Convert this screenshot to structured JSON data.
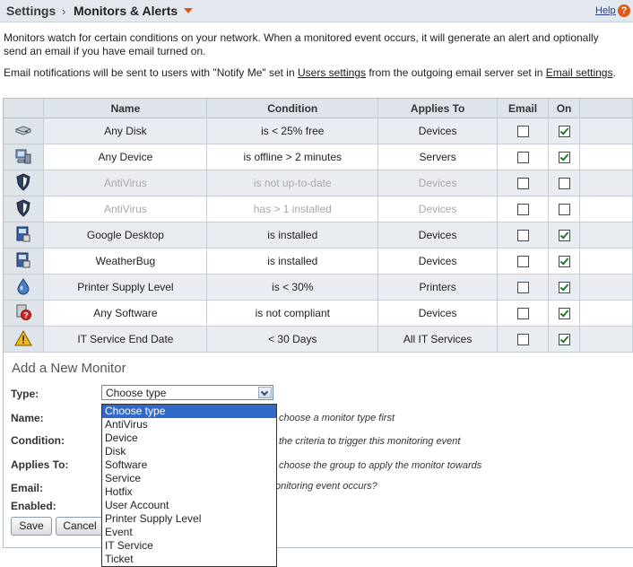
{
  "header": {
    "root": "Settings",
    "separator": "›",
    "current": "Monitors & Alerts",
    "help": "Help",
    "help_icon_glyph": "?"
  },
  "intro": "Monitors watch for certain conditions on your network. When a monitored event occurs, it will generate an alert and optionally send an email if you have email turned on.",
  "email_note": {
    "before": "Email notifications will be sent to users with \"Notify Me\" set in ",
    "link1": "Users settings",
    "middle": " from the outgoing email server set in ",
    "link2": "Email settings",
    "after": "."
  },
  "table": {
    "headers": [
      "",
      "Name",
      "Condition",
      "Applies To",
      "Email",
      "On",
      ""
    ],
    "rows": [
      {
        "icon": "disk-icon",
        "name": "Any Disk",
        "condition": "is < 25% free",
        "applies_to": "Devices",
        "email": false,
        "on": true,
        "disabled": false
      },
      {
        "icon": "device-icon",
        "name": "Any Device",
        "condition": "is offline > 2 minutes",
        "applies_to": "Servers",
        "email": false,
        "on": true,
        "disabled": false
      },
      {
        "icon": "antivirus-shield-icon",
        "name": "AntiVirus",
        "condition": "is not up-to-date",
        "applies_to": "Devices",
        "email": false,
        "on": false,
        "disabled": true
      },
      {
        "icon": "antivirus-shield-icon",
        "name": "AntiVirus",
        "condition": "has > 1 installed",
        "applies_to": "Devices",
        "email": false,
        "on": false,
        "disabled": true
      },
      {
        "icon": "software-icon",
        "name": "Google Desktop",
        "condition": "is installed",
        "applies_to": "Devices",
        "email": false,
        "on": true,
        "disabled": false
      },
      {
        "icon": "software-icon",
        "name": "WeatherBug",
        "condition": "is installed",
        "applies_to": "Devices",
        "email": false,
        "on": true,
        "disabled": false
      },
      {
        "icon": "ink-drop-icon",
        "name": "Printer Supply Level",
        "condition": "is < 30%",
        "applies_to": "Printers",
        "email": false,
        "on": true,
        "disabled": false
      },
      {
        "icon": "software-question-icon",
        "name": "Any Software",
        "condition": "is not compliant",
        "applies_to": "Devices",
        "email": false,
        "on": true,
        "disabled": false
      },
      {
        "icon": "warning-triangle-icon",
        "name": "IT Service End Date",
        "condition": "< 30 Days",
        "applies_to": "All IT Services",
        "email": false,
        "on": true,
        "disabled": false
      }
    ]
  },
  "form": {
    "title": "Add a New Monitor",
    "type_label": "Type:",
    "type_value": "Choose type",
    "name_label": "Name:",
    "name_hint": "choose a monitor type first",
    "condition_label": "Condition:",
    "condition_hint": "the criteria to trigger this monitoring event",
    "applies_label": "Applies To:",
    "applies_hint": "choose the group to apply the monitor towards",
    "email_label": "Email:",
    "email_hint": "onitoring event occurs?",
    "enabled_label": "Enabled:",
    "save": "Save",
    "cancel": "Cancel"
  },
  "dropdown": {
    "selected_index": 0,
    "options": [
      "Choose type",
      "AntiVirus",
      "Device",
      "Disk",
      "Software",
      "Service",
      "Hotfix",
      "User Account",
      "Printer Supply Level",
      "Event",
      "IT Service",
      "Ticket"
    ]
  },
  "colors": {
    "header_bg": "#e3e8ee",
    "accent_caret": "#e0561b",
    "selected_option": "#3169c6",
    "checkmark": "#1e7a2a"
  }
}
